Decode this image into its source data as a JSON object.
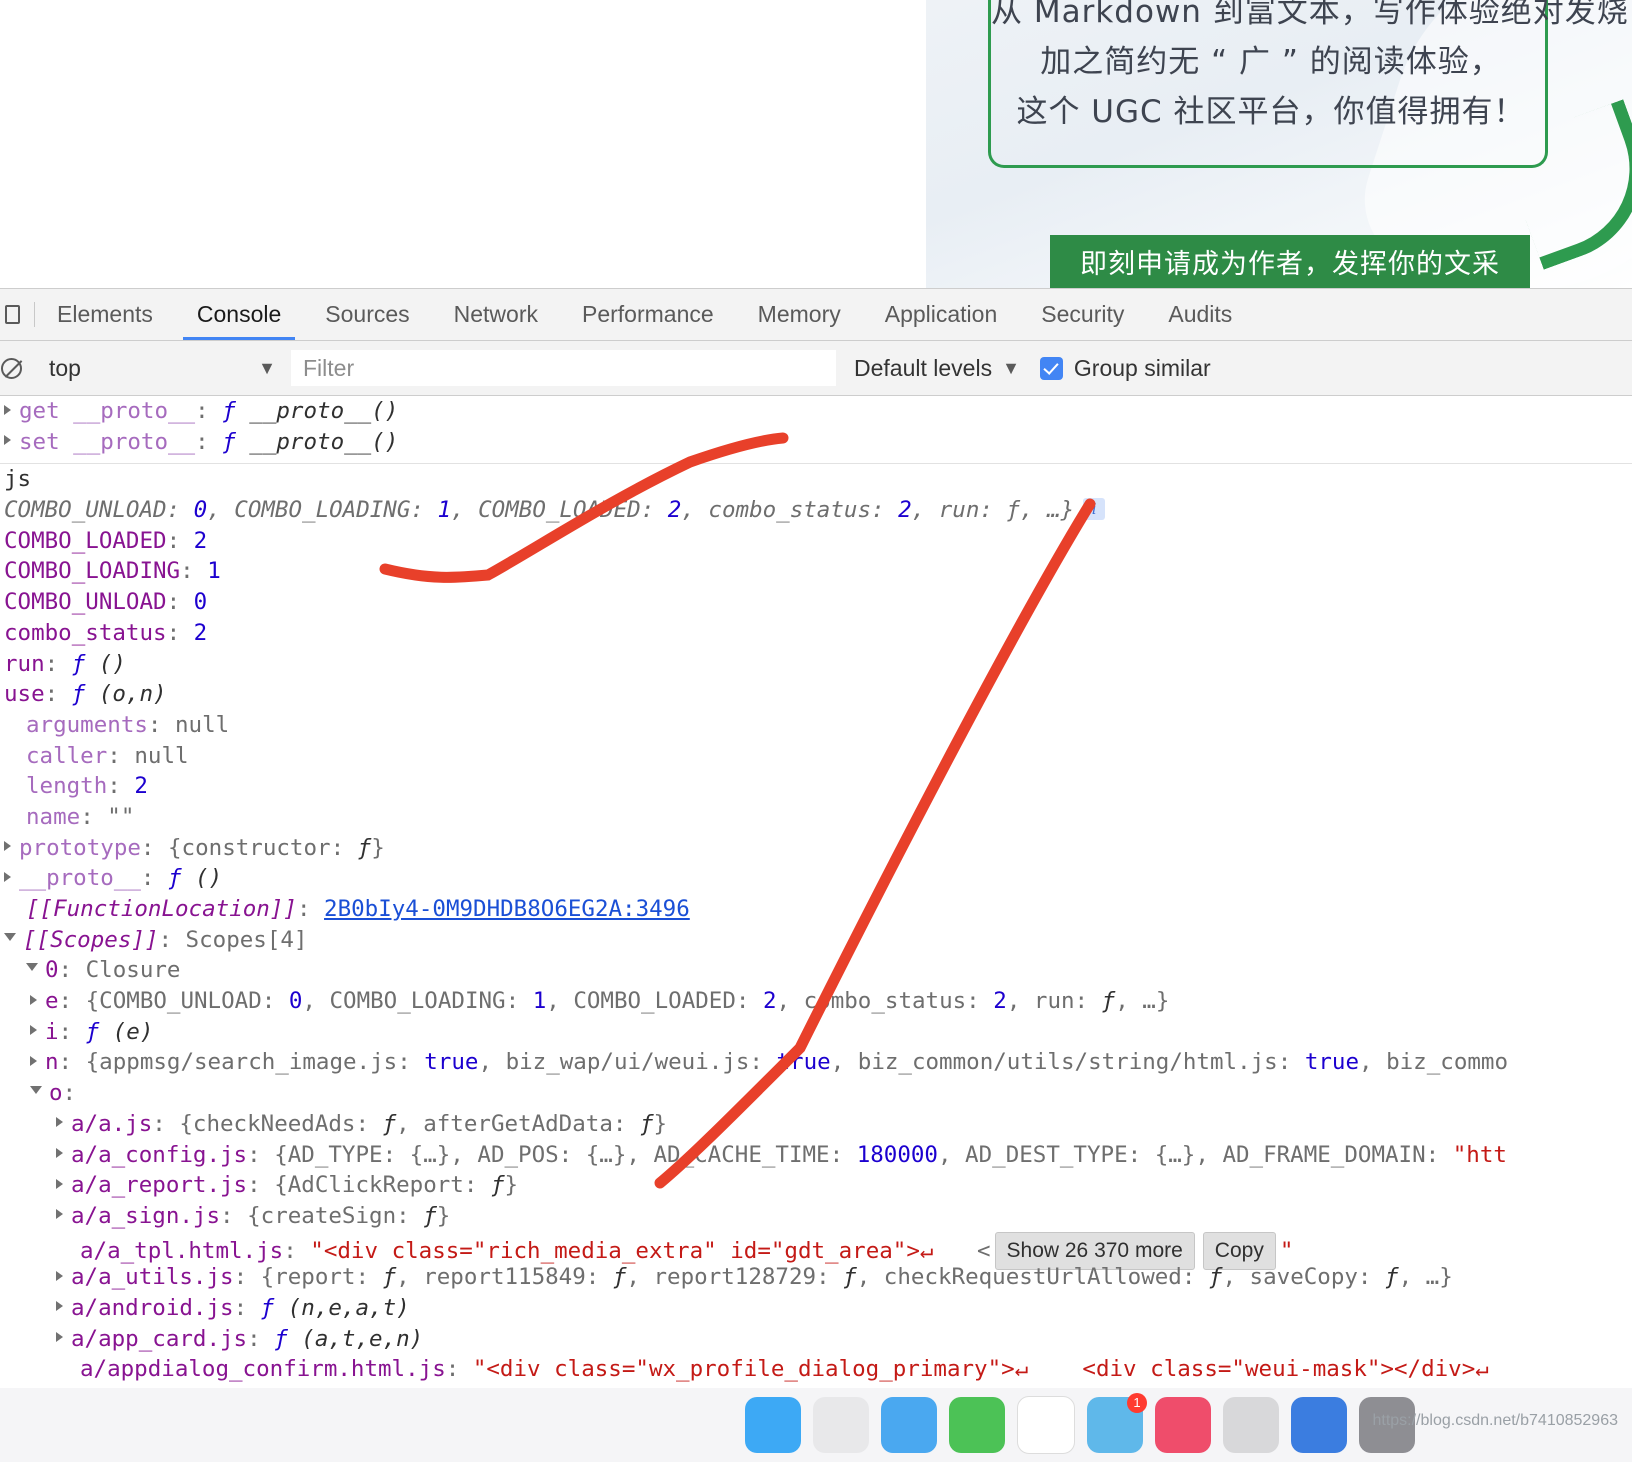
{
  "webpage": {
    "promo_lines": [
      "从 Markdown 到富文本，写作体验绝对发烧",
      "加之简约无 “ 广 ” 的阅读体验，",
      "这个 UGC 社区平台，你值得拥有！"
    ],
    "cta_label": "即刻申请成为作者，发挥你的文采",
    "accent_green": "#2e8b46"
  },
  "devtools": {
    "tabs": [
      {
        "label": "Elements",
        "active": false
      },
      {
        "label": "Console",
        "active": true
      },
      {
        "label": "Sources",
        "active": false
      },
      {
        "label": "Network",
        "active": false
      },
      {
        "label": "Performance",
        "active": false
      },
      {
        "label": "Memory",
        "active": false
      },
      {
        "label": "Application",
        "active": false
      },
      {
        "label": "Security",
        "active": false
      },
      {
        "label": "Audits",
        "active": false
      }
    ],
    "active_tab_underline_color": "#4285f4",
    "toolbar": {
      "dock_icon": "dock-panel-icon",
      "clear_icon": "clear-console-icon",
      "context": "top",
      "context_caret": "▼",
      "filter_value": "",
      "filter_placeholder": "Filter",
      "levels_label": "Default levels",
      "levels_caret": "▼",
      "group_similar_label": "Group similar",
      "group_similar_checked": true,
      "checkbox_color": "#4285f4"
    },
    "console": {
      "rows": [
        {
          "id": "get-proto",
          "indent": 1,
          "arrow": "closed",
          "text": "get __proto__: ƒ __proto__()"
        },
        {
          "id": "set-proto",
          "indent": 1,
          "arrow": "closed",
          "text": "set __proto__: ƒ __proto__()"
        },
        {
          "id": "js-label",
          "indent": 1,
          "arrow": "none",
          "text": "js"
        },
        {
          "id": "object-summary",
          "indent": 1,
          "arrow": "none",
          "text": "COMBO_UNLOAD: 0, COMBO_LOADING: 1, COMBO_LOADED: 2, combo_status: 2, run: ƒ, …}"
        },
        {
          "id": "combo-loaded",
          "indent": 1,
          "arrow": "none",
          "text": "COMBO_LOADED: 2"
        },
        {
          "id": "combo-loading",
          "indent": 1,
          "arrow": "none",
          "text": "COMBO_LOADING: 1"
        },
        {
          "id": "combo-unload",
          "indent": 1,
          "arrow": "none",
          "text": "COMBO_UNLOAD: 0"
        },
        {
          "id": "combo-status",
          "indent": 1,
          "arrow": "none",
          "text": "combo_status: 2"
        },
        {
          "id": "run",
          "indent": 1,
          "arrow": "none",
          "text": "run: ƒ ()"
        },
        {
          "id": "use",
          "indent": 1,
          "arrow": "none",
          "text": "use: ƒ (o,n)"
        },
        {
          "id": "arguments",
          "indent": 2,
          "arrow": "none",
          "text": "arguments: null"
        },
        {
          "id": "caller",
          "indent": 2,
          "arrow": "none",
          "text": "caller: null"
        },
        {
          "id": "length",
          "indent": 2,
          "arrow": "none",
          "text": "length: 2"
        },
        {
          "id": "name",
          "indent": 2,
          "arrow": "none",
          "text": "name: \"\""
        },
        {
          "id": "prototype",
          "indent": 1,
          "arrow": "closed",
          "text": "prototype: {constructor: ƒ}"
        },
        {
          "id": "proto",
          "indent": 1,
          "arrow": "closed",
          "text": "__proto__: ƒ ()"
        },
        {
          "id": "function-location",
          "indent": 2,
          "arrow": "none",
          "text": "[[FunctionLocation]]: 2B0bIy4-0M9DHDB8O6EG2A:3496"
        },
        {
          "id": "scopes",
          "indent": 1,
          "arrow": "open",
          "text": "[[Scopes]]: Scopes[4]"
        },
        {
          "id": "scope-0",
          "indent": 2,
          "arrow": "open",
          "text": "0: Closure"
        },
        {
          "id": "scope-e",
          "indent": 3,
          "arrow": "closed",
          "text": "e: {COMBO_UNLOAD: 0, COMBO_LOADING: 1, COMBO_LOADED: 2, combo_status: 2, run: ƒ, …}"
        },
        {
          "id": "scope-i",
          "indent": 3,
          "arrow": "closed",
          "text": "i: ƒ (e)"
        },
        {
          "id": "scope-n",
          "indent": 3,
          "arrow": "closed",
          "text": "n: {appmsg/search_image.js: true, biz_wap/ui/weui.js: true, biz_common/utils/string/html.js: true, biz_commo"
        },
        {
          "id": "scope-o",
          "indent": 3,
          "arrow": "open",
          "text": "o:"
        },
        {
          "id": "a-a-js",
          "indent": 4,
          "arrow": "closed",
          "text": "a/a.js: {checkNeedAds: ƒ, afterGetAdData: ƒ}"
        },
        {
          "id": "a-a-config-js",
          "indent": 4,
          "arrow": "closed",
          "text": "a/a_config.js: {AD_TYPE: {…}, AD_POS: {…}, AD_CACHE_TIME: 180000, AD_DEST_TYPE: {…}, AD_FRAME_DOMAIN: \"htt"
        },
        {
          "id": "a-a-report-js",
          "indent": 4,
          "arrow": "closed",
          "text": "a/a_report.js: {AdClickReport: ƒ}"
        },
        {
          "id": "a-a-sign-js",
          "indent": 4,
          "arrow": "closed",
          "text": "a/a_sign.js: {createSign: ƒ}"
        },
        {
          "id": "a-a-tpl-html-js",
          "indent": 4,
          "arrow": "none",
          "text": "a/a_tpl.html.js: \"<div class=\"rich_media_extra\" id=\"gdt_area\">↵"
        },
        {
          "id": "a-a-utils-js",
          "indent": 4,
          "arrow": "closed",
          "text": "a/a_utils.js: {report: ƒ, report115849: ƒ, report128729: ƒ, checkRequestUrlAllowed: ƒ, saveCopy: ƒ, …}"
        },
        {
          "id": "a-android-js",
          "indent": 4,
          "arrow": "closed",
          "text": "a/android.js: ƒ (n,e,a,t)"
        },
        {
          "id": "a-app-card-js",
          "indent": 4,
          "arrow": "closed",
          "text": "a/app_card.js: ƒ (a,t,e,n)"
        },
        {
          "id": "a-appdialog-js",
          "indent": 4,
          "arrow": "none",
          "text": "a/appdialog_confirm.html.js: \"<div class=\"wx_profile_dialog_primary\">↵    <div class=\"weui-mask\"></div>↵"
        }
      ],
      "string_truncation": {
        "leading_chevron": "<",
        "show_more_label": "Show 26 370 more",
        "copy_label": "Copy",
        "trailing_quote": "\""
      },
      "info_badge": "i"
    }
  },
  "annotation": {
    "color": "#e8402a",
    "description": "hand-drawn red arrow lines"
  },
  "taskbar": {
    "watermark": "https://blog.csdn.net/b7410852963",
    "dock_apps": [
      {
        "name": "finder",
        "color": "#3da9f5",
        "badge": ""
      },
      {
        "name": "safari",
        "color": "#e8e8ea",
        "badge": ""
      },
      {
        "name": "mail",
        "color": "#4aa8f0",
        "badge": ""
      },
      {
        "name": "wechat",
        "color": "#4cc256",
        "badge": ""
      },
      {
        "name": "qq",
        "color": "#ffffff",
        "badge": ""
      },
      {
        "name": "notes",
        "color": "#5fb8ea",
        "badge": "1"
      },
      {
        "name": "music",
        "color": "#ef4d6b",
        "badge": ""
      },
      {
        "name": "photos",
        "color": "#d8d8da",
        "badge": ""
      },
      {
        "name": "terminal",
        "color": "#3b7de0",
        "badge": ""
      },
      {
        "name": "settings",
        "color": "#8e8e93",
        "badge": ""
      }
    ]
  }
}
